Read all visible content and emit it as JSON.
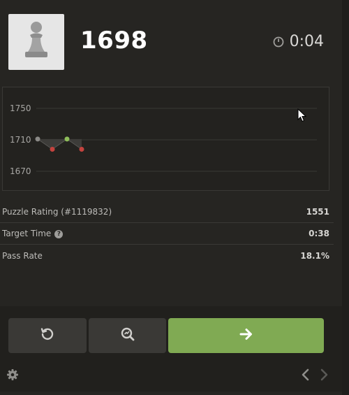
{
  "header": {
    "rating": "1698",
    "timer": "0:04",
    "avatar_icon": "pawn-icon",
    "timer_icon": "stopwatch-icon"
  },
  "graph": {
    "y_ticks": [
      "1750",
      "1710",
      "1670"
    ]
  },
  "chart_data": {
    "type": "line",
    "title": "",
    "xlabel": "",
    "ylabel": "",
    "ylim": [
      1650,
      1770
    ],
    "y_ticks": [
      1750,
      1710,
      1670
    ],
    "grid": true,
    "series": [
      {
        "values": [
          1711,
          1698,
          1711,
          1698
        ],
        "results": [
          "start",
          "fail",
          "pass",
          "fail"
        ],
        "point_colors": [
          "#8b8a87",
          "#c4433e",
          "#8ebd5a",
          "#c4433e"
        ]
      }
    ]
  },
  "stats": {
    "puzzle_rating_label": "Puzzle Rating (#1119832)",
    "puzzle_rating_value": "1551",
    "target_time_label": "Target Time",
    "target_time_help": "?",
    "target_time_value": "0:38",
    "pass_rate_label": "Pass Rate",
    "pass_rate_value": "18.1%"
  },
  "controls": {
    "retry_icon": "retry-icon",
    "analyze_icon": "analysis-icon",
    "next_icon": "arrow-right-icon",
    "settings_icon": "gear-icon",
    "prev_icon": "chevron-left-icon",
    "forward_icon": "chevron-right-icon"
  },
  "colors": {
    "accent_green": "#80aa53",
    "fail_red": "#c4433e",
    "panel_bg": "#262522"
  }
}
